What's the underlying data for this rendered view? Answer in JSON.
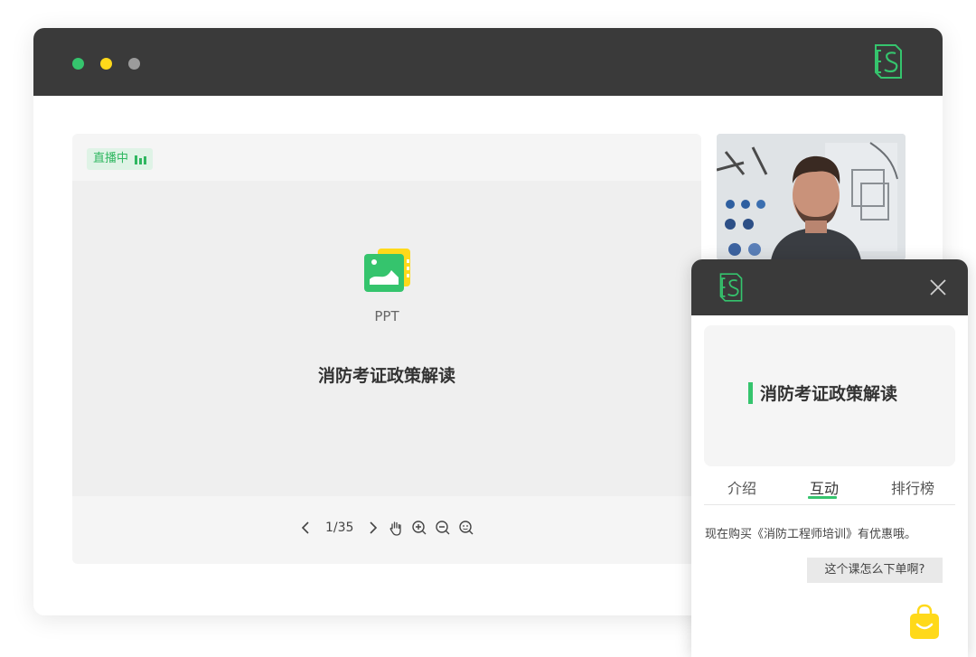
{
  "window": {
    "controls": [
      "close",
      "minimize",
      "maximize"
    ],
    "colors": {
      "titlebar": "#3a3a3a",
      "accent": "#35c46d",
      "dot_green": "#35c46d",
      "dot_yellow": "#ffd91a",
      "dot_gray": "#9b9b9b"
    }
  },
  "player": {
    "live_badge": "直播中",
    "content_type": "PPT",
    "title": "消防考证政策解读",
    "page": "1/35",
    "icons": [
      "chevron-left-icon",
      "chevron-right-icon",
      "hand-icon",
      "zoom-in-icon",
      "zoom-out-icon",
      "zoom-reset-icon"
    ]
  },
  "mobile_panel": {
    "course_title": "消防考证政策解读",
    "tabs": [
      "介绍",
      "互动",
      "排行榜"
    ],
    "active_tab": "互动",
    "messages": [
      "现在购买《消防工程师培训》有优惠哦。",
      "这个课怎么下单啊?"
    ]
  }
}
